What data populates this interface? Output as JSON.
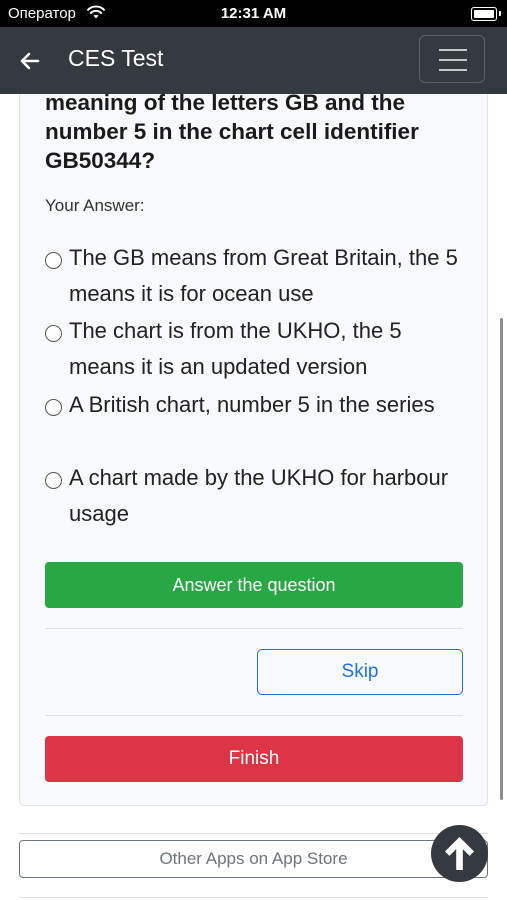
{
  "status_bar": {
    "carrier": "Оператор",
    "time": "12:31 AM"
  },
  "navbar": {
    "title": "CES Test"
  },
  "question": {
    "text": "meaning of the letters GB and the number 5 in the chart cell identifier GB50344?"
  },
  "answer_label": "Your Answer:",
  "options": [
    {
      "label": "The GB means from Great Britain, the 5 means it is for ocean use",
      "selected": false
    },
    {
      "label": "The chart is from the UKHO, the 5 means it is an updated version",
      "selected": false
    },
    {
      "label": "A British chart, number 5 in the series",
      "selected": false
    },
    {
      "label": "A chart made by the UKHO for harbour usage",
      "selected": false
    }
  ],
  "buttons": {
    "answer": "Answer the question",
    "skip": "Skip",
    "finish": "Finish",
    "other_apps": "Other Apps on App Store"
  },
  "colors": {
    "navbar": "#343a40",
    "answer": "#28a745",
    "skip": "#1a73e8",
    "finish": "#dc3545"
  }
}
